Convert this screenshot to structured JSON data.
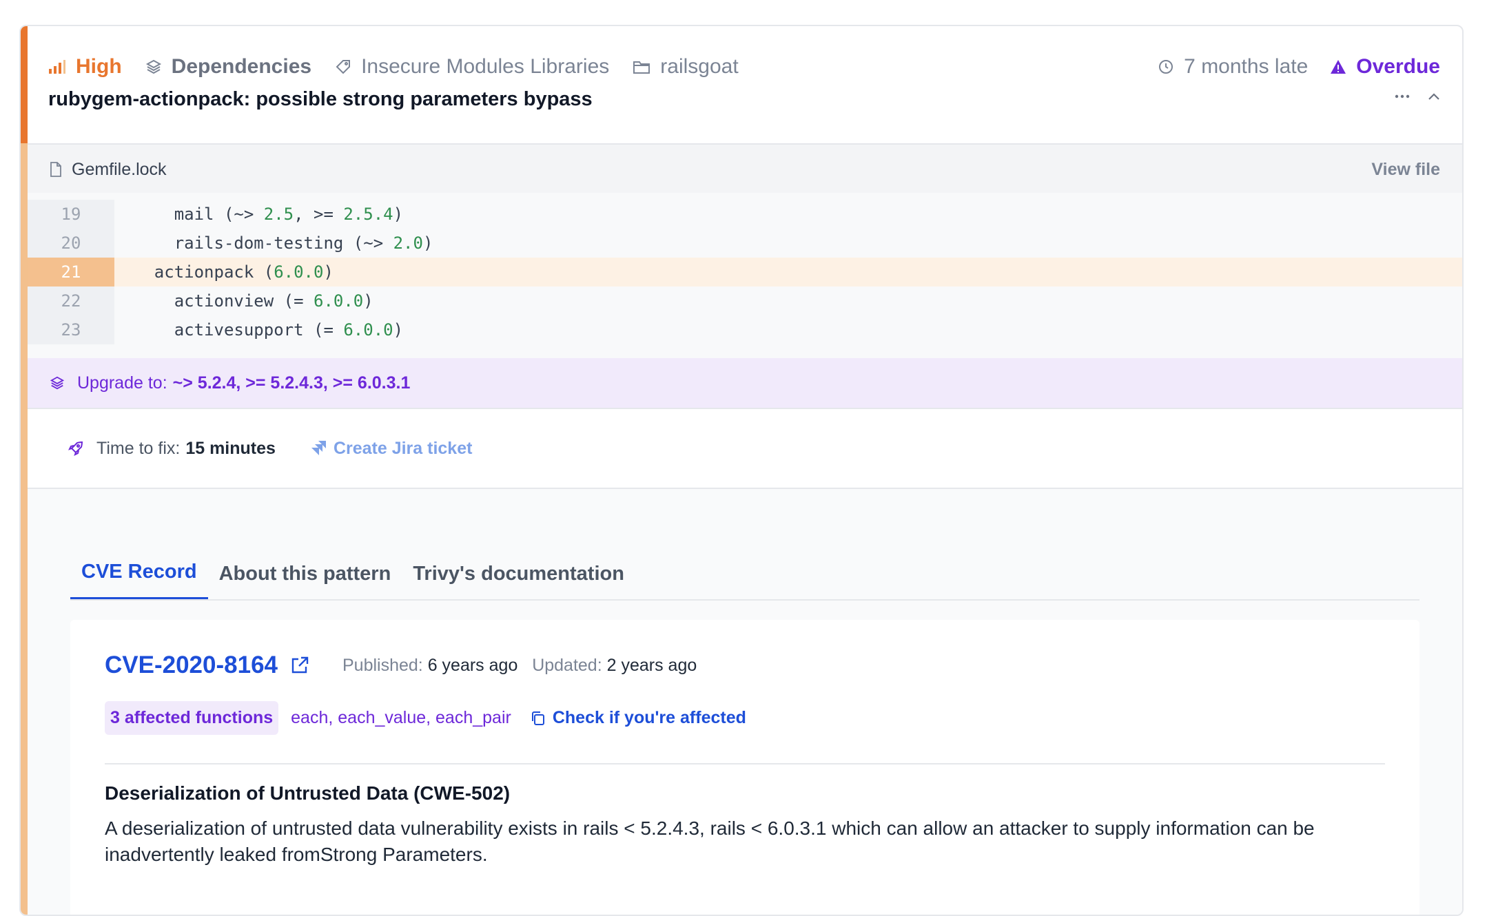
{
  "header": {
    "severity": "High",
    "category": "Dependencies",
    "pattern": "Insecure Modules Libraries",
    "repository": "railsgoat",
    "late": "7 months late",
    "status": "Overdue",
    "title": "rubygem-actionpack: possible strong parameters bypass",
    "more_icon": "ellipsis-icon",
    "collapse_icon": "chevron-up-icon"
  },
  "file": {
    "name": "Gemfile.lock",
    "view_label": "View file",
    "lines": [
      {
        "num": "19",
        "indent": "      ",
        "text": "mail (~> ",
        "parts": [
          "2.5",
          ", >= ",
          "2.5.4",
          ")"
        ]
      },
      {
        "num": "20",
        "indent": "      ",
        "text": "rails-dom-testing (~> ",
        "parts": [
          "2.0",
          ")"
        ]
      },
      {
        "num": "21",
        "indent": "    ",
        "text": "actionpack (",
        "parts": [
          "6.0.0",
          ")"
        ],
        "highlight": true
      },
      {
        "num": "22",
        "indent": "      ",
        "text": "actionview (= ",
        "parts": [
          "6.0.0",
          ")"
        ]
      },
      {
        "num": "23",
        "indent": "      ",
        "text": "activesupport (= ",
        "parts": [
          "6.0.0",
          ")"
        ]
      }
    ]
  },
  "upgrade": {
    "label": "Upgrade to:",
    "versions": "~> 5.2.4, >= 5.2.4.3, >= 6.0.3.1"
  },
  "fix": {
    "label": "Time to fix:",
    "value": "15 minutes",
    "jira_label": "Create Jira ticket"
  },
  "tabs": [
    "CVE Record",
    "About this pattern",
    "Trivy's documentation"
  ],
  "cve": {
    "id": "CVE-2020-8164",
    "published_label": "Published:",
    "published_value": "6 years ago",
    "updated_label": "Updated:",
    "updated_value": "2 years ago",
    "badge": "3 affected functions",
    "functions": "each, each_value, each_pair",
    "check_label": "Check if you're affected",
    "cwe_title": "Deserialization of Untrusted Data (CWE-502)",
    "description": "A deserialization of untrusted data vulnerability exists in rails < 5.2.4.3, rails < 6.0.3.1 which can allow an attacker to supply information can be inadvertently leaked fromStrong Parameters."
  },
  "colors": {
    "severity": "#e8762e",
    "overdue": "#6d28d9",
    "link": "#1d4ed8",
    "highlight_line": "#f4c08e"
  }
}
